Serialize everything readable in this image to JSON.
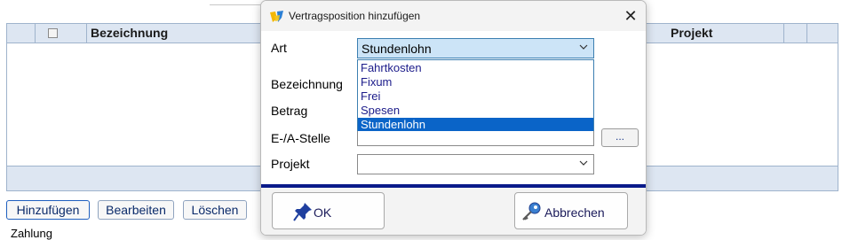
{
  "grid": {
    "columns": [
      "Bezeichnung",
      "Projekt"
    ]
  },
  "page_buttons": {
    "add": "Hinzufügen",
    "edit": "Bearbeiten",
    "delete": "Löschen"
  },
  "footer_text": "Zahlung",
  "dialog": {
    "title": "Vertragsposition hinzufügen",
    "close_glyph": "✕",
    "fields": {
      "art_label": "Art",
      "art_value": "Stundenlohn",
      "art_options": [
        "Fahrtkosten",
        "Fixum",
        "Frei",
        "Spesen",
        "Stundenlohn"
      ],
      "art_selected_index": 4,
      "bezeichnung_label": "Bezeichnung",
      "betrag_label": "Betrag",
      "ea_stelle_label": "E-/A-Stelle",
      "projekt_label": "Projekt",
      "browse_button": "..."
    },
    "buttons": {
      "ok": "OK",
      "cancel": "Abbrechen"
    },
    "icons": {
      "title": "app-logo-icon",
      "ok": "pushpin-icon",
      "cancel": "key-icon"
    },
    "colors": {
      "separator": "#0a1a8a",
      "selected_option": "#0a64c8",
      "open_select": "#cce4f7"
    }
  }
}
